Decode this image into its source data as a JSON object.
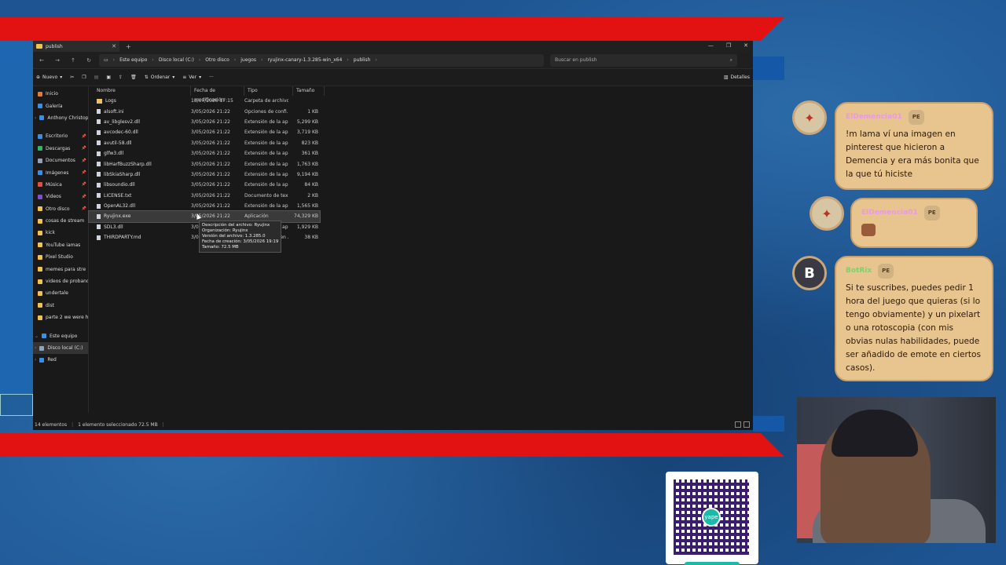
{
  "window": {
    "tab_title": "publish",
    "breadcrumbs": [
      "Este equipo",
      "Disco local (C:)",
      "Otro disco",
      "juegos",
      "ryujinx-canary-1.3.285-win_x64",
      "publish"
    ],
    "search_placeholder": "Buscar en publish"
  },
  "toolbar": {
    "new_label": "Nuevo",
    "sort_label": "Ordenar",
    "view_label": "Ver",
    "more_label": "···",
    "details_label": "Detalles"
  },
  "sidebar": {
    "items": [
      {
        "label": "Inicio",
        "color": "#e07b39"
      },
      {
        "label": "Galería",
        "color": "#3a8ee6"
      },
      {
        "label": "Anthony Christoph",
        "color": "#3a8ee6"
      }
    ],
    "quick": [
      {
        "label": "Escritorio",
        "color": "#3a8ee6"
      },
      {
        "label": "Descargas",
        "color": "#2fb56a"
      },
      {
        "label": "Documentos",
        "color": "#8ea3b8"
      },
      {
        "label": "Imágenes",
        "color": "#3a8ee6"
      },
      {
        "label": "Música",
        "color": "#e0503a"
      },
      {
        "label": "Videos",
        "color": "#7a4fd0"
      },
      {
        "label": "Otro disco",
        "color": "#f2c14e"
      },
      {
        "label": "cosas de stream",
        "color": "#f2c14e"
      },
      {
        "label": "kick",
        "color": "#f2c14e"
      },
      {
        "label": "YouTube iamas",
        "color": "#f2c14e"
      },
      {
        "label": "Pixel Studio",
        "color": "#f2c14e"
      },
      {
        "label": "memes para stre",
        "color": "#f2c14e"
      },
      {
        "label": "videos de probando",
        "color": "#f2c14e"
      },
      {
        "label": "undertale",
        "color": "#f2c14e"
      },
      {
        "label": "dist",
        "color": "#f2c14e"
      },
      {
        "label": "parte 2 we were her",
        "color": "#f2c14e"
      }
    ],
    "tree": [
      {
        "label": "Este equipo",
        "color": "#3a8ee6"
      },
      {
        "label": "Disco local (C:)",
        "color": "#8ea3b8"
      },
      {
        "label": "Red",
        "color": "#3a8ee6"
      }
    ]
  },
  "columns": [
    "Nombre",
    "Fecha de modificación",
    "Tipo",
    "Tamaño"
  ],
  "files": [
    {
      "name": "Logs",
      "date": "18/07/2026 17:15",
      "type": "Carpeta de archivos",
      "size": "",
      "folder": true
    },
    {
      "name": "alsoft.ini",
      "date": "3/05/2026 21:22",
      "type": "Opciones de confi...",
      "size": "1 KB"
    },
    {
      "name": "av_libglesv2.dll",
      "date": "3/05/2026 21:22",
      "type": "Extensión de la apl...",
      "size": "5,299 KB"
    },
    {
      "name": "avcodec-60.dll",
      "date": "3/05/2026 21:22",
      "type": "Extensión de la apl...",
      "size": "3,719 KB"
    },
    {
      "name": "avutil-58.dll",
      "date": "3/05/2026 21:22",
      "type": "Extensión de la apl...",
      "size": "823 KB"
    },
    {
      "name": "glfw3.dll",
      "date": "3/05/2026 21:22",
      "type": "Extensión de la apl...",
      "size": "361 KB"
    },
    {
      "name": "libHarfBuzzSharp.dll",
      "date": "3/05/2026 21:22",
      "type": "Extensión de la apl...",
      "size": "1,763 KB"
    },
    {
      "name": "libSkiaSharp.dll",
      "date": "3/05/2026 21:22",
      "type": "Extensión de la apl...",
      "size": "9,194 KB"
    },
    {
      "name": "libsoundio.dll",
      "date": "3/05/2026 21:22",
      "type": "Extensión de la apl...",
      "size": "84 KB"
    },
    {
      "name": "LICENSE.txt",
      "date": "3/05/2026 21:22",
      "type": "Documento de tex...",
      "size": "2 KB"
    },
    {
      "name": "OpenAL32.dll",
      "date": "3/05/2026 21:22",
      "type": "Extensión de la apl...",
      "size": "1,565 KB"
    },
    {
      "name": "Ryujinx.exe",
      "date": "3/05/2026 21:22",
      "type": "Aplicación",
      "size": "74,329 KB",
      "selected": true
    },
    {
      "name": "SDL3.dll",
      "date": "3/05/2026 21:22",
      "type": "Extensión de la apl...",
      "size": "1,929 KB"
    },
    {
      "name": "THIRDPARTY.md",
      "date": "3/05/2026 21:22",
      "type": "Archivo de origen ...",
      "size": "38 KB"
    }
  ],
  "tooltip": {
    "lines": [
      "Descripción del archivo: Ryujinx",
      "Organización: Ryujinx",
      "Versión del archivo: 1.3.285.0",
      "Fecha de creación: 3/05/2026 19:19",
      "Tamaño: 72.5 MB"
    ]
  },
  "status": {
    "count": "14 elementos",
    "selection": "1 elemento seleccionado  72.5 MB"
  },
  "chat": {
    "messages": [
      {
        "user": "ElDemencia01",
        "badge": "PE",
        "text": "!m lama ví una imagen en pinterest que hicieron a Demencia y era más bonita que la que tú hiciste"
      },
      {
        "user": "ElDemencia01",
        "badge": "PE",
        "text": ""
      },
      {
        "user": "BotRix",
        "badge": "PE",
        "avatar_letter": "B",
        "text": "Si te suscribes, puedes pedir 1 hora del juego que quieras (si lo tengo obviamente) y un pixelart o una rotoscopia (con mis obvias nulas habilidades, puede ser añadido de emote en ciertos casos)."
      }
    ]
  },
  "qr": {
    "logo_text": "yape"
  }
}
